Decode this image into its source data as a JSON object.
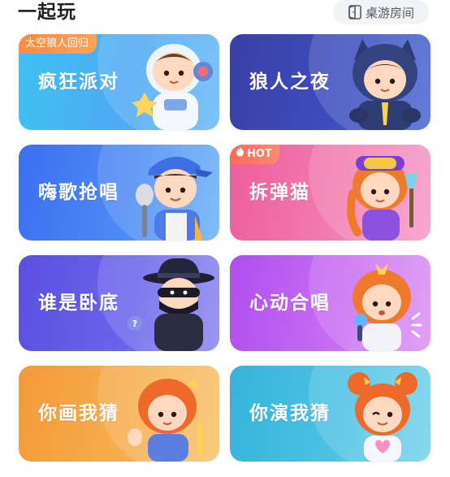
{
  "header": {
    "title": "一起玩",
    "board_game_room": "桌游房间"
  },
  "cards": [
    {
      "label": "疯狂派对",
      "tag": "太空狼人回归",
      "art": "astronaut-character"
    },
    {
      "label": "狼人之夜",
      "tag": "",
      "art": "werewolf-character"
    },
    {
      "label": "嗨歌抢唱",
      "tag": "",
      "art": "singer-character"
    },
    {
      "label": "拆弹猫",
      "tag": "HOT",
      "art": "explorer-girl-character"
    },
    {
      "label": "谁是卧底",
      "tag": "",
      "art": "spy-character"
    },
    {
      "label": "心动合唱",
      "tag": "",
      "art": "singing-girl-character"
    },
    {
      "label": "你画我猜",
      "tag": "",
      "art": "painter-girl-character"
    },
    {
      "label": "你演我猜",
      "tag": "",
      "art": "winking-girl-character"
    }
  ]
}
